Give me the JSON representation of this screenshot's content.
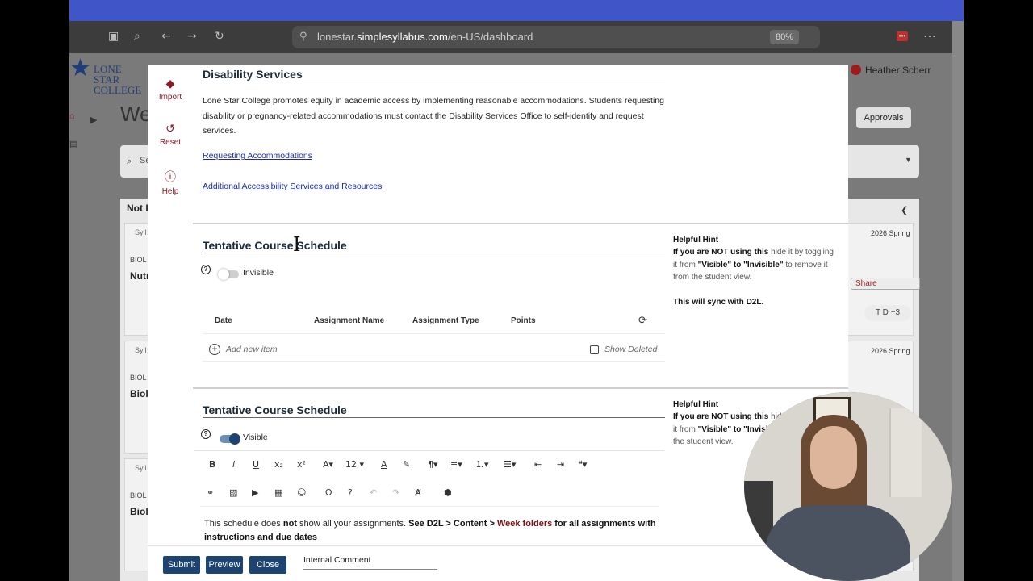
{
  "browser": {
    "url_prefix": "lonestar.",
    "url_domain": "simplesyllabus.com",
    "url_path": "/en-US/dashboard",
    "zoom": "80%"
  },
  "background_app": {
    "logo_line1": "LONE STAR",
    "logo_line2": "COLLEGE",
    "user_name": "Heather Scherr",
    "welcome": "We",
    "approvals": "Approvals",
    "search_placeholder": "Se",
    "not_started": "Not I",
    "term_1": "2026 Spring",
    "term_2": "2026 Spring",
    "share": "Share",
    "avatars": "T D +3",
    "card_tag": "Syll",
    "card_course": "BIOL",
    "card_title_1": "Nutr",
    "card_title_2": "Biolo",
    "card_title_3": "Biolo"
  },
  "sidebar": {
    "import": "Import",
    "reset": "Reset",
    "help": "Help"
  },
  "disability": {
    "title": "Disability Services",
    "paragraph": "Lone Star College promotes equity in academic access by implementing reasonable accommodations. Students requesting disability or pregnancy-related accommodations must contact the Disability Services Office to self-identify and request services.",
    "link1": "Requesting Accommodations",
    "link2": "Additional Accessibility Services and Resources"
  },
  "schedule1": {
    "title": "Tentative Course Schedule",
    "visibility": "Invisible",
    "columns": [
      "Date",
      "Assignment Name",
      "Assignment Type",
      "Points"
    ],
    "add_item": "Add new item",
    "show_deleted": "Show Deleted"
  },
  "hint1": {
    "title": "Helpful Hint",
    "text_a": "If you are NOT using this",
    "text_b": " hide it by toggling it from ",
    "text_c": "\"Visible\" to \"Invisible\"",
    "text_d": " to remove it from the student view.",
    "sync": "This will sync with D2L."
  },
  "schedule2": {
    "title": "Tentative Course Schedule",
    "visibility": "Visible",
    "font_size": "12",
    "editor_a": "This schedule does ",
    "editor_b": "not",
    "editor_c": " show all your assignments. ",
    "editor_d": "See D2L > Content > ",
    "editor_e": "Week folders",
    "editor_f": " for all assignments with instructions and due dates"
  },
  "hint2": {
    "title": "Helpful Hint",
    "text_a": "If you are NOT using this",
    "text_b": " hide it by toggling it from ",
    "text_c": "\"Visible\" to \"Invisib",
    "text_d": "the student view."
  },
  "footer": {
    "submit": "Submit",
    "preview": "Preview",
    "close": "Close",
    "comment_placeholder": "Internal Comment"
  },
  "colors": {
    "brand_navy": "#1d4370",
    "accent_maroon": "#8a1a2a",
    "link_blue": "#1b2f9c"
  }
}
